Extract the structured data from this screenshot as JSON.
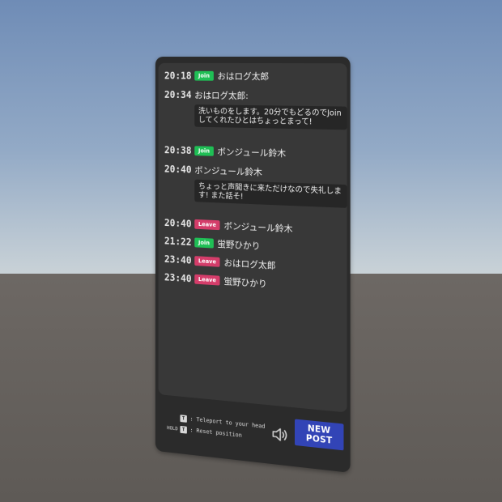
{
  "log": [
    {
      "time": "20:18",
      "badge": "Join",
      "badge_type": "join",
      "name": "おはログ太郎"
    },
    {
      "time": "20:34",
      "name": "おはログ太郎:",
      "message": "洗いものをします。20分でもどるのでJoinしてくれたひとはちょっとまって!"
    },
    {
      "time": "20:38",
      "badge": "Join",
      "badge_type": "join",
      "name": "ボンジュール鈴木"
    },
    {
      "time": "20:40",
      "name": "ボンジュール鈴木",
      "message": "ちょっと声聞きに来ただけなので失礼します! また話そ!"
    },
    {
      "time": "20:40",
      "badge": "Leave",
      "badge_type": "leave",
      "name": "ボンジュール鈴木"
    },
    {
      "time": "21:22",
      "badge": "Join",
      "badge_type": "join",
      "name": "蛍野ひかり"
    },
    {
      "time": "23:40",
      "badge": "Leave",
      "badge_type": "leave",
      "name": "おはログ太郎"
    },
    {
      "time": "23:40",
      "badge": "Leave",
      "badge_type": "leave",
      "name": "蛍野ひかり"
    }
  ],
  "footer": {
    "hint1": {
      "key": "T",
      "text": ": Teleport to your head"
    },
    "hint2": {
      "prefix": "HOLD",
      "key": "T",
      "text": ": Reset position"
    },
    "speaker_icon": "speaker-icon",
    "new_post_label": "NEW POST"
  },
  "colors": {
    "join": "#1fbf55",
    "leave": "#d43d6a",
    "button": "#3244b6"
  }
}
